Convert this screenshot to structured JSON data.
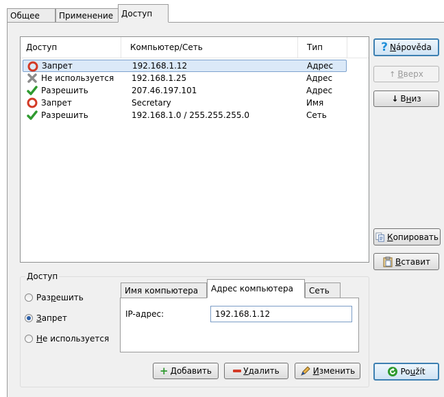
{
  "tabs": [
    "Общее",
    "Применение",
    "Доступ"
  ],
  "list": {
    "columns": [
      "Доступ",
      "Компьютер/Сеть",
      "Тип"
    ],
    "rows": [
      {
        "access": "Запрет",
        "host": "192.168.1.12",
        "type": "Адрес",
        "icon": "deny-icon",
        "selected": true
      },
      {
        "access": "Не используется",
        "host": "192.168.1.25",
        "type": "Адрес",
        "icon": "unused-icon",
        "selected": false
      },
      {
        "access": "Разрешить",
        "host": "207.46.197.101",
        "type": "Адрес",
        "icon": "allow-icon",
        "selected": false
      },
      {
        "access": "Запрет",
        "host": "Secretary",
        "type": "Имя",
        "icon": "deny-icon",
        "selected": false
      },
      {
        "access": "Разрешить",
        "host": "192.168.1.0 / 255.255.255.0",
        "type": "Сеть",
        "icon": "allow-icon",
        "selected": false
      }
    ]
  },
  "side": {
    "help": {
      "u": "N",
      "rest": "ápověda"
    },
    "up": {
      "u": "В",
      "rest": "верх"
    },
    "down": {
      "pre": "В",
      "u": "н",
      "rest": "из"
    },
    "copy": {
      "u": "К",
      "rest": "опировать"
    },
    "paste": {
      "u": "В",
      "rest": "ставит"
    },
    "apply": {
      "pre": "Po",
      "u": "u",
      "rest": "žít"
    }
  },
  "access_group": {
    "title": "Доступ",
    "radios": [
      {
        "pre": "Раз",
        "u": "р",
        "rest": "ешить",
        "checked": false
      },
      {
        "pre": "",
        "u": "З",
        "rest": "апрет",
        "checked": true
      },
      {
        "pre": "",
        "u": "Н",
        "rest": "е используется",
        "checked": false
      }
    ],
    "tabs": [
      "Имя компьютера",
      "Адрес компьютера",
      "Сеть"
    ],
    "ip_label": "IP-адрес:",
    "ip_value": "192.168.1.12",
    "buttons": {
      "add": {
        "u": "Д",
        "rest": "обавить"
      },
      "delete": {
        "u": "У",
        "rest": "далить"
      },
      "edit": {
        "u": "И",
        "rest": "зменить"
      }
    }
  },
  "colors": {
    "allow": "#2f9a2f",
    "deny": "#d33a26",
    "unused": "#8c8c8c",
    "selection": "#dbe9f8",
    "help": "#1e8fd8"
  }
}
